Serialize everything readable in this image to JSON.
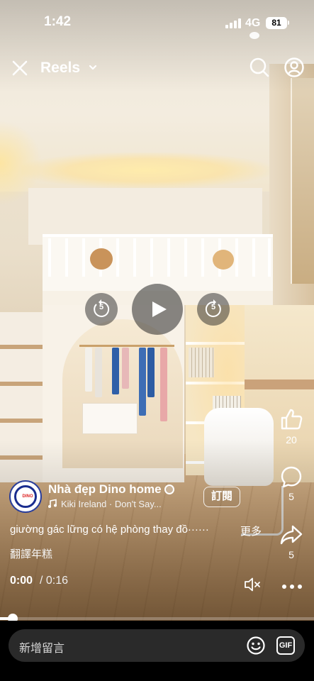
{
  "status_bar": {
    "time": "1:42",
    "network": "4G",
    "battery": "81"
  },
  "nav": {
    "title": "Reels"
  },
  "player": {
    "seek_back": "5",
    "seek_forward": "5",
    "current_time": "0:00",
    "total_time": "/ 0:16",
    "progress": 0.04
  },
  "actions": {
    "likes": "20",
    "comments": "5",
    "shares": "5"
  },
  "post": {
    "author": "Nhà đẹp Dino home",
    "avatar_text": "DINO",
    "music": "Kiki Ireland · Don't Say...",
    "follow_label": "訂閱",
    "caption": "giường gác lững có hệ phòng thay đồ······",
    "more_label": "更多",
    "translate_label": "翻譯年糕"
  },
  "composer": {
    "placeholder": "新增留言",
    "gif_label": "GIF"
  },
  "icons": [
    "close-icon",
    "chevron-down-icon",
    "search-icon",
    "profile-icon",
    "play-icon",
    "replay-5-icon",
    "forward-5-icon",
    "like-icon",
    "comment-icon",
    "share-icon",
    "music-icon",
    "mute-icon",
    "more-icon",
    "emoji-icon",
    "gif-icon"
  ]
}
